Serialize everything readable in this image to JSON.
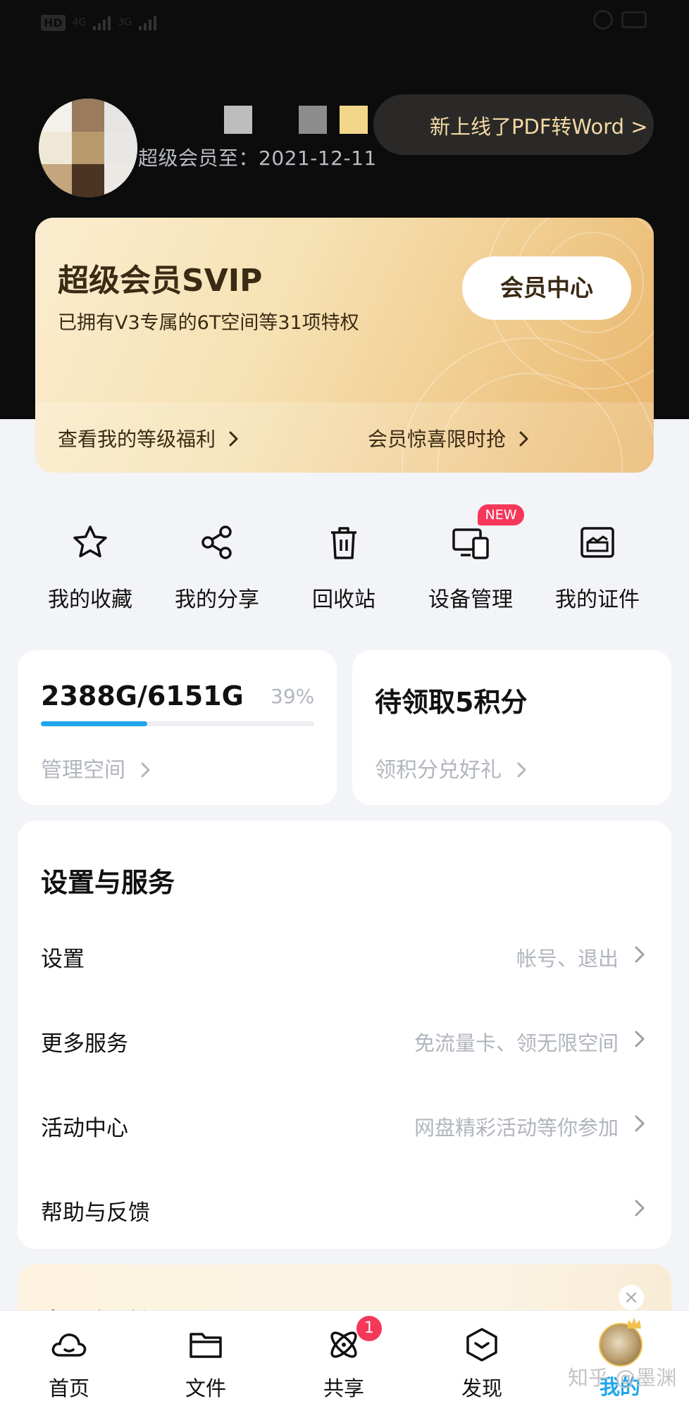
{
  "status_bar": {
    "network_left": "HD",
    "net_1": "4G",
    "net_2": "3G"
  },
  "header": {
    "vip_expiry": "超级会员至：2021-12-11",
    "promo_pill": "新上线了PDF转Word >"
  },
  "vip_card": {
    "title": "超级会员SVIP",
    "subtitle": "已拥有V3专属的6T空间等31项特权",
    "center_button": "会员中心",
    "link_benefits": "查看我的等级福利",
    "link_surprise": "会员惊喜限时抢"
  },
  "quick_actions": [
    {
      "label": "我的收藏",
      "icon": "star-icon"
    },
    {
      "label": "我的分享",
      "icon": "share-icon"
    },
    {
      "label": "回收站",
      "icon": "trash-icon"
    },
    {
      "label": "设备管理",
      "icon": "devices-icon",
      "badge": "NEW"
    },
    {
      "label": "我的证件",
      "icon": "id-card-icon"
    }
  ],
  "storage": {
    "used_total": "2388G/6151G",
    "percent_text": "39%",
    "fraction": 0.39,
    "link": "管理空间"
  },
  "points": {
    "title": "待领取5积分",
    "link": "领积分兑好礼"
  },
  "settings": {
    "title": "设置与服务",
    "rows": [
      {
        "label": "设置",
        "value": "帐号、退出"
      },
      {
        "label": "更多服务",
        "value": "免流量卡、领无限空间"
      },
      {
        "label": "活动中心",
        "value": "网盘精彩活动等你参加"
      },
      {
        "label": "帮助与反馈",
        "value": ""
      }
    ]
  },
  "promo_card": {
    "title": "专属福利",
    "close": "×"
  },
  "tabbar": {
    "items": [
      {
        "label": "首页",
        "icon": "cloud-icon"
      },
      {
        "label": "文件",
        "icon": "folder-icon"
      },
      {
        "label": "共享",
        "icon": "share-planet-icon",
        "badge": "1"
      },
      {
        "label": "发现",
        "icon": "discover-icon"
      },
      {
        "label": "我的",
        "icon": "profile-avatar-icon",
        "active": true
      }
    ]
  },
  "watermark": "知乎 @墨渊",
  "colors": {
    "accent": "#1ea5ec",
    "badge": "#f5375a",
    "gold_text": "#3b2a14"
  }
}
